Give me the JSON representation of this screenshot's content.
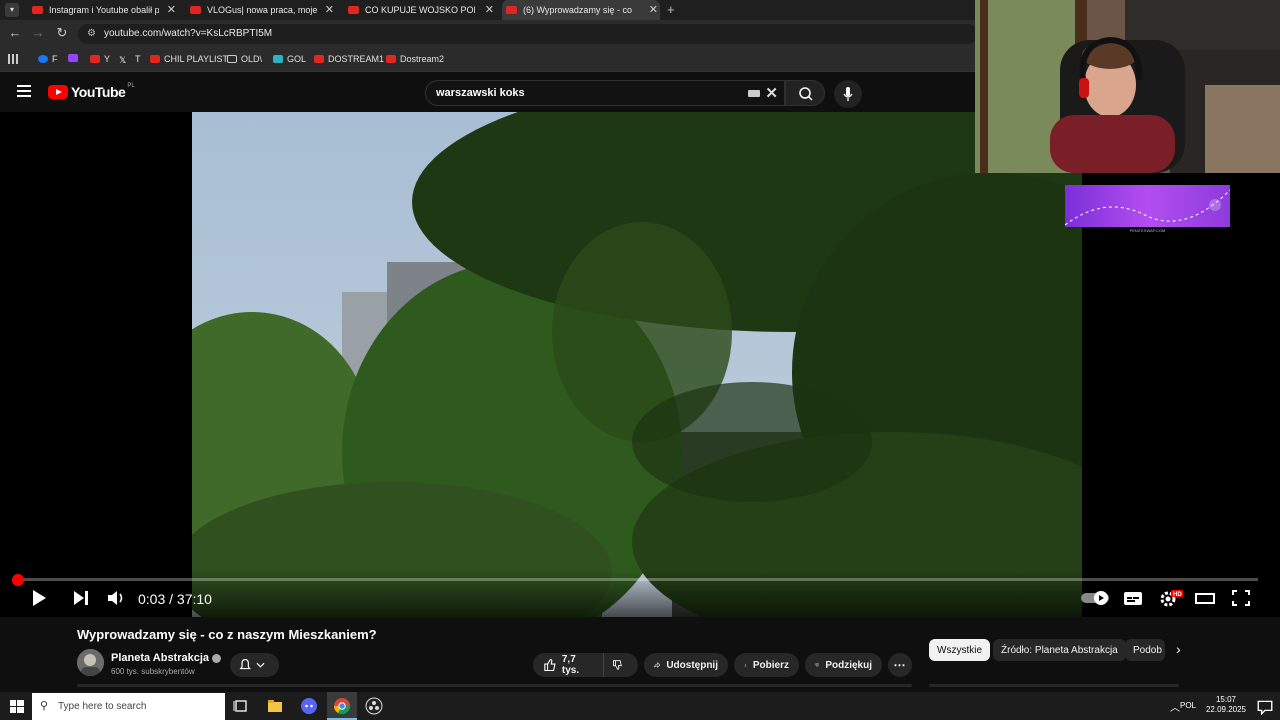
{
  "browser": {
    "tabs": [
      {
        "title": "Instagram i Youtube obalił pańs"
      },
      {
        "title": "VLOGus| nowa praca, moje prze"
      },
      {
        "title": "CO KUPUJE WOJSKO POLSKIE"
      },
      {
        "title": "(6) Wyprowadzamy się - co z na"
      }
    ],
    "url": "youtube.com/watch?v=KsLcRBPTI5M",
    "bookmarks": [
      {
        "label": "F"
      },
      {
        "label": ""
      },
      {
        "label": "Y"
      },
      {
        "label": "T"
      },
      {
        "label": "CHIL PLAYLIST"
      },
      {
        "label": "OLD\\"
      },
      {
        "label": "GOL"
      },
      {
        "label": "DOSTREAM1"
      },
      {
        "label": "Dostream2"
      }
    ]
  },
  "youtube": {
    "logo_text": "YouTube",
    "region": "PL",
    "search_query": "warszawski koks"
  },
  "player": {
    "time": "0:03 / 37:10",
    "progress_fraction": 0.0013
  },
  "overlay": {
    "banner_text": "PIRATESWAP.COM"
  },
  "video": {
    "title": "Wyprowadzamy się - co z naszym Mieszkaniem?",
    "channel": "Planeta Abstrakcja",
    "subscribers": "600 tys. subskrybentów",
    "likes": "7,7 tys.",
    "share_label": "Udostępnij",
    "download_label": "Pobierz",
    "thanks_label": "Podziękuj"
  },
  "chips": [
    {
      "label": "Wszystkie"
    },
    {
      "label": "Źródło: Planeta Abstrakcja"
    },
    {
      "label": "Podob"
    }
  ],
  "taskbar": {
    "search_placeholder": "Type here to search",
    "language": "POL",
    "time": "15:07",
    "date": "22.09.2025"
  },
  "colors": {
    "accent": "#ff0000",
    "background": "#0f0f0f"
  }
}
